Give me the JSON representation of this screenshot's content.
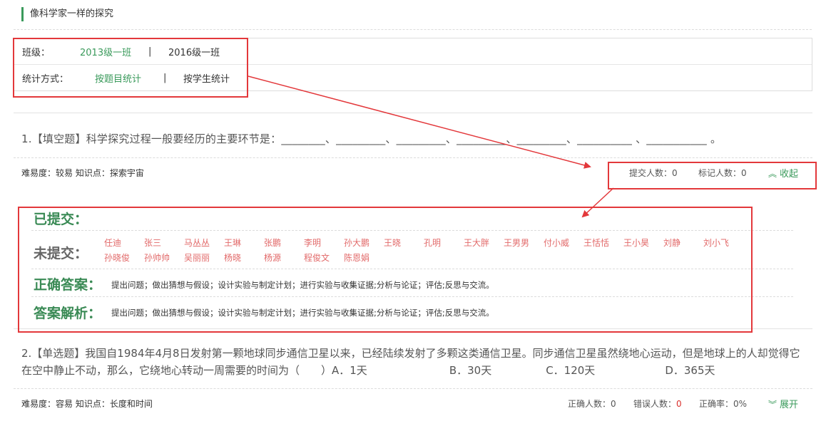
{
  "page": {
    "title": "像科学家一样的探究"
  },
  "filters": {
    "class_label": "班级：",
    "class_options": [
      "2013级一班",
      "2016级一班"
    ],
    "class_separator": "|",
    "stat_label": "统计方式：",
    "stat_options": [
      "按题目统计",
      "按学生统计"
    ],
    "stat_separator": "|"
  },
  "q1": {
    "text": "1.【填空题】科学探究过程一般要经历的主要环节是：________、_________、_________、_________、_________、__________ 、___________ 。",
    "meta": "难易度：较易 知识点：探索宇宙",
    "submit_count": "提交人数：0",
    "mark_count": "标记人数：0",
    "toggle_label": "收起",
    "submitted_label": "已提交：",
    "unsubmitted_label": "未提交：",
    "unsubmitted_students": [
      "任迪",
      "张三",
      "马丛丛",
      "王琳",
      "张鹏",
      "李明",
      "孙大鹏",
      "王晓",
      "孔明",
      "王大胖",
      "王男男",
      "付小威",
      "王恬恬",
      "王小昊",
      "刘静",
      "刘小飞",
      "孙晓俊",
      "孙帅帅",
      "吴丽丽",
      "杨晓",
      "杨源",
      "程俊文",
      "陈恩娟"
    ],
    "correct_label": "正确答案：",
    "correct_text": "提出问题；做出猜想与假设；设计实验与制定计划；进行实验与收集证据;分析与论证；评估;反思与交流。",
    "analysis_label": "答案解析：",
    "analysis_text": "提出问题；做出猜想与假设；设计实验与制定计划；进行实验与收集证据;分析与论证；评估;反思与交流。"
  },
  "q2": {
    "text_prefix": "2.【单选题】我国自1984年4月8日发射第一颗地球同步通信卫星以来，已经陆续发射了多颗这类通信卫星。同步通信卫星虽然绕地心运动，但是地球上的人却觉得它在空中静止不动，那么，它绕地心转动一周需要的时间为（　　）A．1天",
    "option_b": "B．30天",
    "option_c": "C．120天",
    "option_d": "D．365天",
    "meta": "难易度：容易 知识点：长度和时间",
    "correct_label": "正确人数：",
    "correct_value": "0",
    "wrong_label": "错误人数：",
    "wrong_value": "0",
    "rate": "正确率：0%",
    "toggle_label": "展开"
  },
  "colors": {
    "accent": "#3a9a5b",
    "annotation": "#e3383b",
    "name_red": "#e26a6a"
  }
}
